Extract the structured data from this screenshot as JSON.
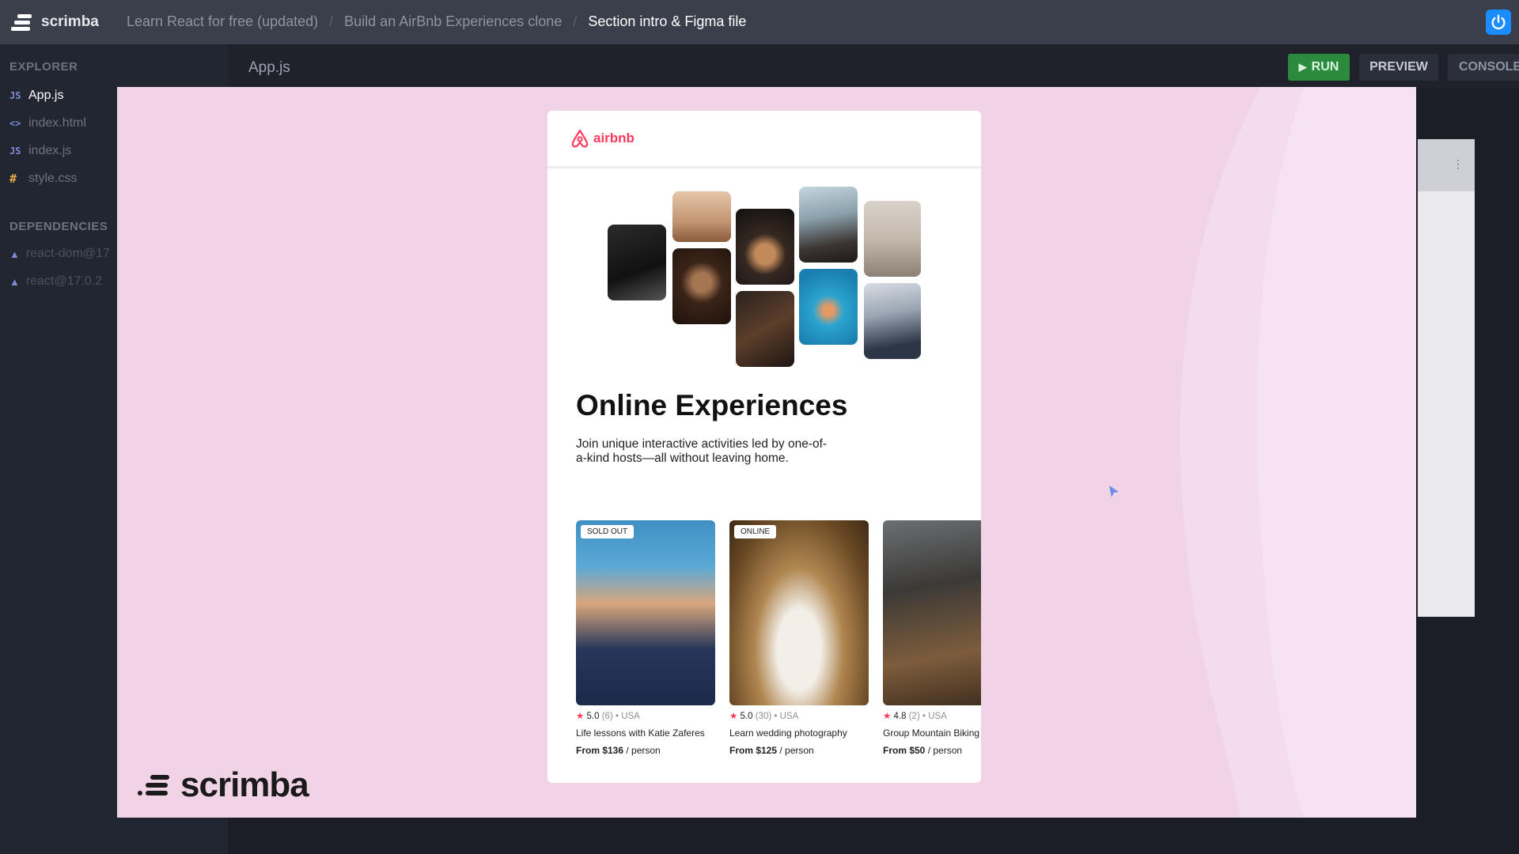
{
  "app": {
    "brand": "scrimba"
  },
  "breadcrumbs": [
    {
      "label": "Learn React for free (updated)"
    },
    {
      "label": "Build an AirBnb Experiences clone"
    },
    {
      "label": "Section intro & Figma file"
    }
  ],
  "sidebar": {
    "explorer_title": "EXPLORER",
    "files": [
      {
        "icon": "JS",
        "label": "App.js"
      },
      {
        "icon": "<>",
        "label": "index.html"
      },
      {
        "icon": "JS",
        "label": "index.js"
      },
      {
        "icon": "#",
        "label": "style.css"
      }
    ],
    "dependencies_title": "DEPENDENCIES",
    "dependencies": [
      {
        "label": "react-dom@17"
      },
      {
        "label": "react@17.0.2"
      }
    ]
  },
  "editor": {
    "active_tab": "App.js",
    "run_label": "RUN",
    "preview_label": "PREVIEW",
    "console_label": "CONSOLE"
  },
  "slide": {
    "logo_text": "scrimba",
    "mock": {
      "logo_text": "airbnb",
      "title": "Online Experiences",
      "subtitle": "Join unique interactive activities led by one-of-a-kind hosts—all without leaving home.",
      "cards": [
        {
          "badge": "SOLD OUT",
          "rating": "5.0",
          "count": "(6)",
          "location": "• USA",
          "title": "Life lessons with Katie Zaferes",
          "price": "From $136",
          "unit": "/ person"
        },
        {
          "badge": "ONLINE",
          "rating": "5.0",
          "count": "(30)",
          "location": "• USA",
          "title": "Learn wedding photography",
          "price": "From $125",
          "unit": "/ person"
        },
        {
          "badge": "",
          "rating": "4.8",
          "count": "(2)",
          "location": "• USA",
          "title": "Group Mountain Biking",
          "price": "From $50",
          "unit": "/ person"
        }
      ]
    }
  },
  "colors": {
    "topbar": "#3b3f4b",
    "sidebar": "#222631",
    "run_button": "#2b8a3e",
    "slide_bg": "#f1d3e6",
    "airbnb_brand": "#ff385c",
    "power_button": "#1a8cff"
  }
}
